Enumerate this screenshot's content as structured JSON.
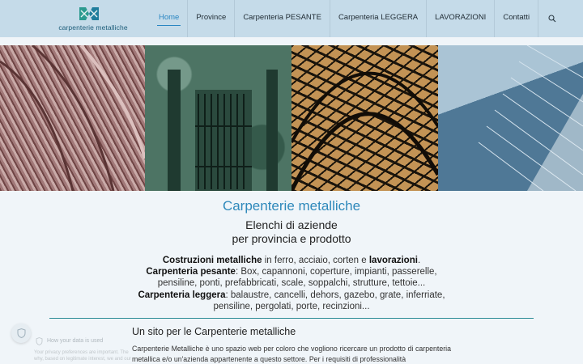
{
  "header": {
    "logo_text": "carpenterie metalliche",
    "nav": [
      "Home",
      "Province",
      "Carpenteria PESANTE",
      "Carpenteria LEGGERA",
      "LAVORAZIONI",
      "Contatti"
    ],
    "active_index": 0,
    "search_icon": "search-icon"
  },
  "hero": {
    "panel_colors": [
      "#a17878",
      "#4d7464",
      "#c39355",
      "#4f7896"
    ]
  },
  "main": {
    "title": "Carpenterie metalliche",
    "subtitle_line1": "Elenchi di aziende",
    "subtitle_line2": "per provincia e prodotto",
    "desc": {
      "b1": "Costruzioni metalliche",
      "t1": " in ferro, acciaio, corten e ",
      "b2": "lavorazioni",
      "t2": ".",
      "b3": "Carpenteria pesante",
      "t3": ": Box, capannoni, coperture, impianti, passerelle, pensiline, ponti, prefabbricati, scale, soppalchi, strutture, tettoie...",
      "b4": "Carpenteria leggera",
      "t4": ": balaustre, cancelli, dehors, gazebo, grate, inferriate, pensiline, pergolati, porte, recinzioni..."
    },
    "section_title": "Un sito per le Carpenterie metalliche",
    "paragraph": "Carpenterie Metalliche è uno spazio web per coloro che vogliono ricercare un prodotto di carpenteria metallica e/o un'azienda appartenente a questo settore. Per i requisiti di professionalità"
  },
  "privacy": {
    "title": "How your data is used",
    "text_line1": "Your privacy preferences are important. The",
    "text_line2": "why, based on legitimate interest, we and our"
  },
  "colors": {
    "accent": "#2f89bb",
    "header_bg": "#c5dbe9",
    "divider": "#2c8c96"
  }
}
